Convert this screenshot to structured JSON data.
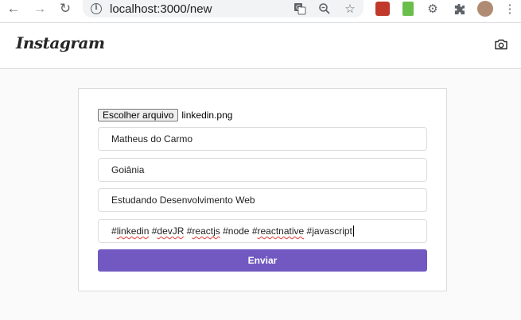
{
  "browser": {
    "url": "localhost:3000/new",
    "back_icon": "arrow-left-icon",
    "forward_icon": "arrow-right-icon",
    "reload_icon": "reload-icon"
  },
  "header": {
    "logo_text": "Instagram",
    "camera_icon": "camera-icon"
  },
  "form": {
    "file_button_label": "Escolher arquivo",
    "file_name": "linkedin.png",
    "author_value": "Matheus do Carmo",
    "place_value": "Goiânia",
    "description_value": "Estudando Desenvolvimento Web",
    "hashtags": {
      "hash1": "#",
      "tag1": "linkedin",
      "hash2": " #",
      "tag2": "devJR",
      "hash3": " #",
      "tag3": "reactjs",
      "rest1": " #node #",
      "tag4": "reactnative",
      "rest2": " #javascript"
    },
    "submit_label": "Enviar"
  },
  "colors": {
    "accent": "#7159c1",
    "page_bg": "#fafafa",
    "border": "#dbdbdb"
  }
}
